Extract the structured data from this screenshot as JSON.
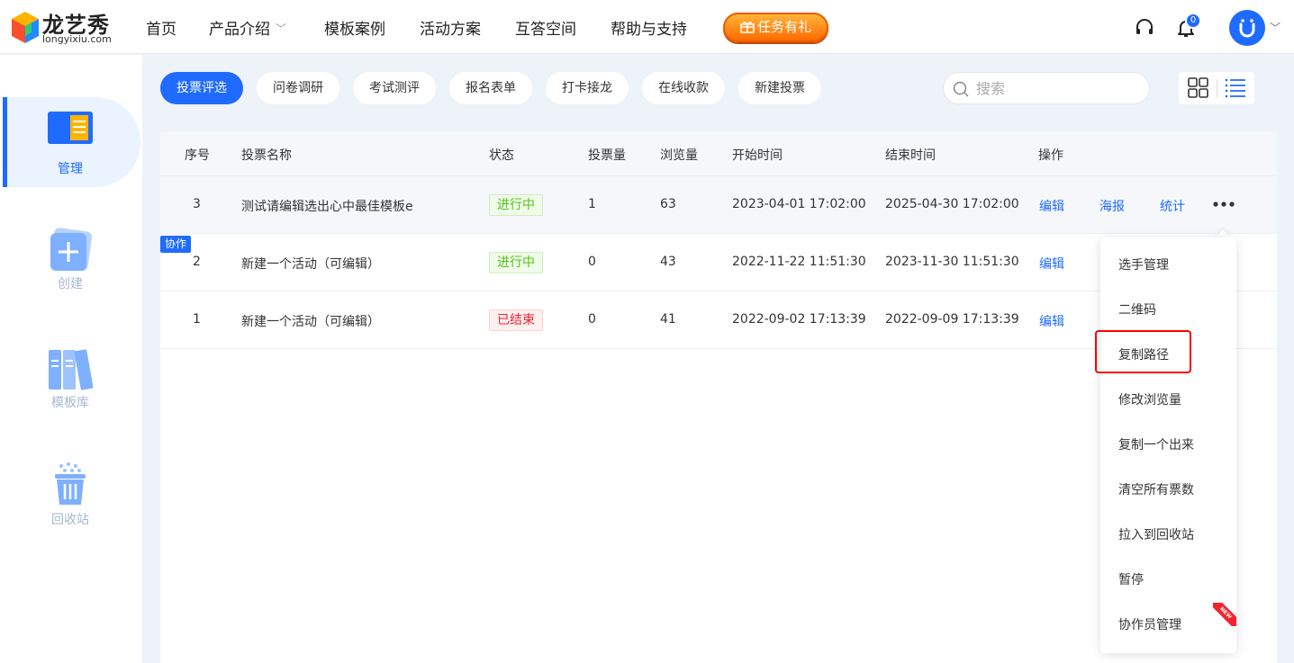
{
  "brand": {
    "name": "龙艺秀",
    "domain": "longyixiu.com"
  },
  "nav": {
    "items": [
      "首页",
      "产品介绍",
      "模板案例",
      "活动方案",
      "互答空间",
      "帮助与支持"
    ],
    "gift_label": "任务有礼"
  },
  "header": {
    "notification_count": "0"
  },
  "sidebar": {
    "items": [
      {
        "label": "管理",
        "icon": "manage-icon",
        "active": true
      },
      {
        "label": "创建",
        "icon": "create-icon"
      },
      {
        "label": "模板库",
        "icon": "template-library-icon"
      },
      {
        "label": "回收站",
        "icon": "recycle-bin-icon"
      }
    ]
  },
  "tabs": [
    "投票评选",
    "问卷调研",
    "考试测评",
    "报名表单",
    "打卡接龙",
    "在线收款",
    "新建投票"
  ],
  "search": {
    "placeholder": "搜索"
  },
  "table": {
    "headers": [
      "序号",
      "投票名称",
      "状态",
      "投票量",
      "浏览量",
      "开始时间",
      "结束时间",
      "操作"
    ],
    "rows": [
      {
        "no": "3",
        "name": "测试请编辑选出心中最佳模板e",
        "status": "进行中",
        "votes": "1",
        "views": "63",
        "start": "2023-04-01 17:02:00",
        "end": "2025-04-30 17:02:00"
      },
      {
        "no": "2",
        "name": "新建一个活动（可编辑）",
        "status": "进行中",
        "votes": "0",
        "views": "43",
        "start": "2022-11-22 11:51:30",
        "end": "2023-11-30 11:51:30"
      },
      {
        "no": "1",
        "name": "新建一个活动（可编辑）",
        "status": "已结束",
        "votes": "0",
        "views": "41",
        "start": "2022-09-02 17:13:39",
        "end": "2022-09-09 17:13:39"
      }
    ],
    "actions": {
      "edit": "编辑",
      "poster": "海报",
      "stats": "统计"
    },
    "collab_tag": "协作"
  },
  "dropdown": {
    "items": [
      "选手管理",
      "二维码",
      "复制路径",
      "修改浏览量",
      "复制一个出来",
      "清空所有票数",
      "拉入到回收站",
      "暂停",
      "协作员管理"
    ],
    "new_badge": "NEW"
  },
  "colors": {
    "primary": "#1f6bff",
    "success": "#52c41a",
    "danger": "#f5222d",
    "gift": "#ff7a00"
  }
}
